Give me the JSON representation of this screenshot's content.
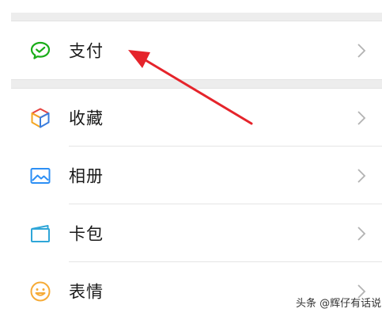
{
  "menu": {
    "payment": {
      "label": "支付",
      "icon": "wechat-pay-icon"
    },
    "favorites": {
      "label": "收藏",
      "icon": "favorites-cube-icon"
    },
    "album": {
      "label": "相册",
      "icon": "photo-album-icon"
    },
    "cards": {
      "label": "卡包",
      "icon": "card-wallet-icon"
    },
    "stickers": {
      "label": "表情",
      "icon": "smiley-icon"
    }
  },
  "watermark": "头条 @辉仔有话说",
  "colors": {
    "pay_green": "#1aad19",
    "favorites_orange": "#f5a623",
    "favorites_blue": "#3b7ddd",
    "favorites_red": "#e64340",
    "album_blue": "#2c8ff5",
    "cards_blue": "#2fa6d8",
    "smiley_orange": "#f6ab37",
    "annotation_red": "#e5242b",
    "chevron_gray": "#b2b2b2",
    "section_gap": "#ededed"
  }
}
